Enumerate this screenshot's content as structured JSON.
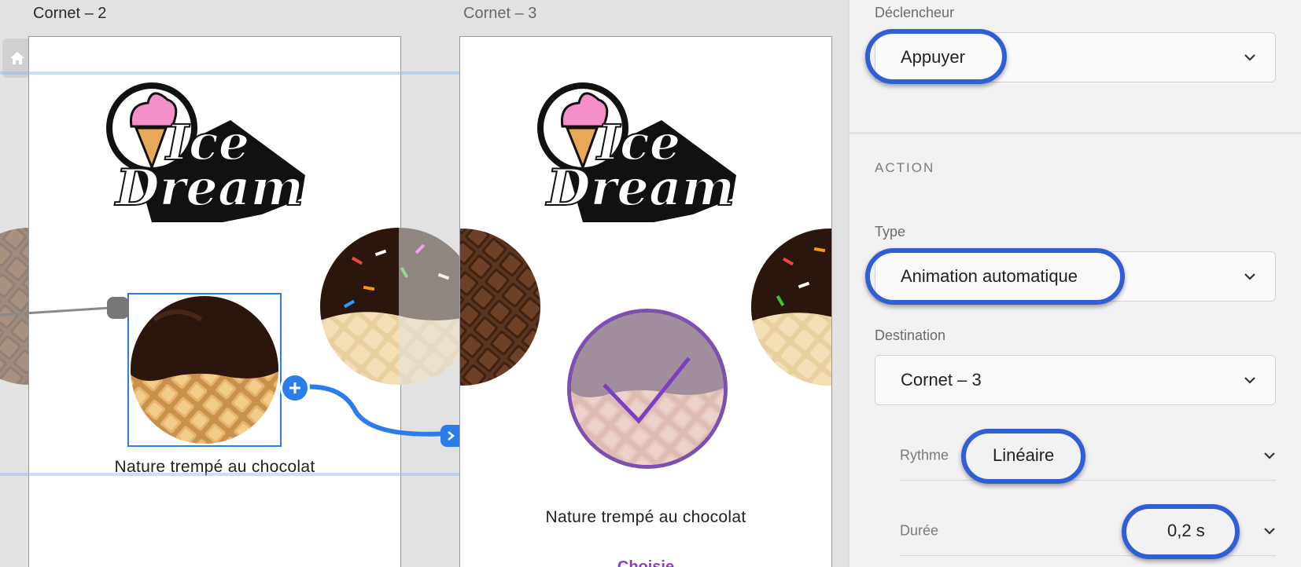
{
  "canvas": {
    "artboards": [
      {
        "title": "Cornet – 2",
        "caption": "Nature trempé au chocolat"
      },
      {
        "title": "Cornet – 3",
        "caption": "Nature trempé au chocolat",
        "status": "Choisie"
      }
    ],
    "logo_text": [
      "Ice",
      "Dream"
    ]
  },
  "inspector": {
    "trigger": {
      "label": "Déclencheur",
      "value": "Appuyer"
    },
    "action_section": "ACTION",
    "type": {
      "label": "Type",
      "value": "Animation automatique"
    },
    "destination": {
      "label": "Destination",
      "value": "Cornet – 3"
    },
    "easing": {
      "label": "Rythme",
      "value": "Linéaire"
    },
    "duration": {
      "label": "Durée",
      "value": "0,2 s"
    }
  },
  "colors": {
    "accent": "#2b7de9",
    "highlight": "#2f5ed6",
    "chosen": "#8a3fc8"
  }
}
